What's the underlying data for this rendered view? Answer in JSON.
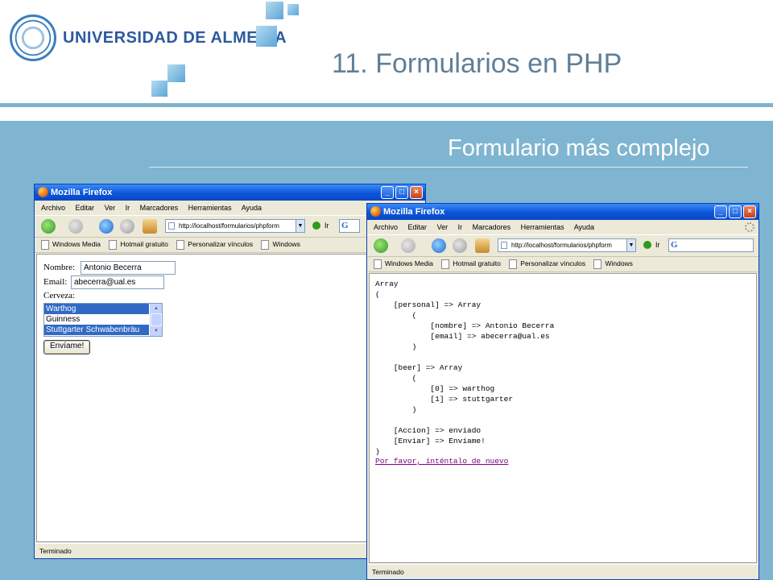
{
  "header": {
    "logo_text": "UNIVERSIDAD DE ALMERIA",
    "slide_title": "11. Formularios en PHP"
  },
  "slide": {
    "subtitle": "Formulario más complejo"
  },
  "browser_left": {
    "window_title": "Mozilla Firefox",
    "menu": [
      "Archivo",
      "Editar",
      "Ver",
      "Ir",
      "Marcadores",
      "Herramientas",
      "Ayuda"
    ],
    "url": "http://localhost/formularios/phpform",
    "go_label": "Ir",
    "bookmarks": [
      "Windows Media",
      "Hotmail gratuito",
      "Personalizar vínculos",
      "Windows"
    ],
    "status": "Terminado",
    "form": {
      "nombre_label": "Nombre:",
      "nombre_value": "Antonio Becerra",
      "email_label": "Email:",
      "email_value": "abecerra@ual.es",
      "cerveza_label": "Cerveza:",
      "options": [
        {
          "label": "Warthog",
          "selected": true
        },
        {
          "label": "Guinness",
          "selected": false
        },
        {
          "label": "Stuttgarter Schwabenbräu",
          "selected": true
        }
      ],
      "submit_label": "Envíame!"
    }
  },
  "browser_right": {
    "window_title": "Mozilla Firefox",
    "menu": [
      "Archivo",
      "Editar",
      "Ver",
      "Ir",
      "Marcadores",
      "Herramientas",
      "Ayuda"
    ],
    "url": "http://localhost/formularios/phpform",
    "go_label": "Ir",
    "bookmarks": [
      "Windows Media",
      "Hotmail gratuito",
      "Personalizar vínculos",
      "Windows"
    ],
    "status": "Terminado",
    "output_text": "Array\n(\n    [personal] => Array\n        (\n            [nombre] => Antonio Becerra\n            [email] => abecerra@ual.es\n        )\n\n    [beer] => Array\n        (\n            [0] => warthog\n            [1] => stuttgarter\n        )\n\n    [Accion] => enviado\n    [Enviar] => Envíame!\n)",
    "retry_link": "Por favor, inténtalo de nuevo"
  },
  "colors": {
    "content_bg": "#7fb5d0",
    "title_color": "#5f7f98",
    "brand_blue": "#2c5aa0",
    "selection": "#316ac5",
    "visited_link": "#800080"
  }
}
